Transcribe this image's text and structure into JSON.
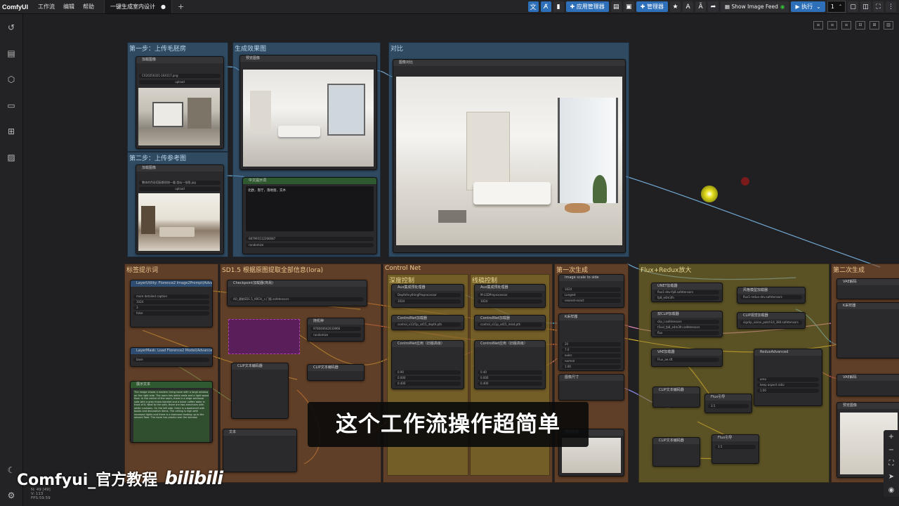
{
  "app": {
    "brand": "ComfyUI"
  },
  "menu": [
    "工作流",
    "编辑",
    "帮助"
  ],
  "tab": {
    "title": "一键生成室内设计",
    "dot": "●",
    "plus": "+"
  },
  "toolbar": {
    "app_manager": "应用管理器",
    "manager": "管理器",
    "show_image_feed": "Show Image Feed",
    "run": "执行",
    "run_count": "1"
  },
  "groups": {
    "step1": "第一步：上传毛胚房",
    "step2": "第二步：上传参考图",
    "result": "生成效果图",
    "compare": "对比",
    "tag": "标签提示词",
    "sd": "SD1.5 根据原图提取全部信息(lora)",
    "controlnet": "Control Net",
    "cn_depth": "深度控制",
    "cn_line": "线稿控制",
    "gen": "第一次生成",
    "flux": "Flux+Redux放大",
    "final": "第二次生成"
  },
  "nodes": {
    "load_image_1": "加载图像",
    "image_file_1": "CX20250321-164117.png",
    "upload_1": "upload",
    "load_image_2": "加载图像",
    "image_file_2": "整体的色彩搭配都很统一暖·类似一张图.jpg",
    "upload_2": "upload",
    "preview_1": "预览图像",
    "compare": "图像对比",
    "note_title": "中文提示词",
    "note_text": "北欧，客厅，落地窗，实木",
    "seed": "687991512266687",
    "control_after": "randomize",
    "florence": "LayerUtility: Florence2 Image2Prompt(Advance)",
    "florence_task": "more detailed caption",
    "florence_max": "1024",
    "florence_beams": "3",
    "florence_sample": "false",
    "florence_model": "LayerMask: Load Florence2 Model(Advance)",
    "florence_version": "base",
    "show_text": "展示文本",
    "show_text_body": "The image shows a modern living room with a large window on the right side. The room has white walls and a light wood floor. In the center of the room, there is a large sectional sofa with a grey throw blanket and a black coffee table in front of it. Next to the sofa, there are two armchairs with white cushions. On the left side, there is a bookshelf with books and decorative items. The ceiling is high with recessed lights and there is a staircase leading up to the second floor. The room has plants near the window.",
    "checkpoint": "Checkpoint加载器(简易)",
    "checkpoint_name": "AO_建筑SD1.5_ARCH_入门版.safetensors",
    "clip_encode": "CLIP文本编码器",
    "seed_node": "随机种",
    "seed_value": "978040642033966",
    "cn_depth_pre": "Aux集成预处理器",
    "cn_depth_model": "DepthAnythingPreprocessor",
    "cn_depth_res": "1024",
    "cn_line_pre": "Aux集成预处理器",
    "cn_line_model": "M-LSDPreprocessor",
    "cn_line_res": "1024",
    "cn_loader_1": "ControlNet加载器",
    "cn_file_1": "control_v11f1p_sd15_depth.pth",
    "cn_loader_2": "ControlNet加载器",
    "cn_file_2": "control_v11p_sd15_mlsd.pth",
    "cn_apply_1": "ControlNet应用（旧版高级）",
    "cn_apply_2": "ControlNet应用（旧版高级）",
    "cn_strength_1": "0.90",
    "cn_start_1": "0.000",
    "cn_end_1": "0.400",
    "cn_strength_2": "0.40",
    "cn_start_2": "0.000",
    "cn_end_2": "0.400",
    "scale": "Image scale to side",
    "scale_side": "1024",
    "scale_mode": "Longest",
    "scale_method": "nearest-exact",
    "ksampler": "K采样器",
    "steps": "20",
    "cfg": "7.0",
    "sampler": "euler",
    "scheduler": "normal",
    "denoise": "1.00",
    "image_size": "图像尺寸",
    "unet": "UNET加载器",
    "unet_name": "flux1-dev-fp8.safetensors",
    "unet_weight": "fp8_e4m3fn",
    "style_model": "风格模型加载器",
    "style_name": "flux1-redux-dev.safetensors",
    "clip_vision": "CLIP视觉加载器",
    "clip_vision_name": "sigclip_vision_patch14_384.safetensors",
    "dual_clip": "双CLIP加载器",
    "clip1": "clip_l.safetensors",
    "clip2": "t5xxl_fp8_e4m3fn.safetensors",
    "clip_type": "flux",
    "vae": "VAE加载器",
    "vae_name": "Flux_ae.sft",
    "redux": "ReduxAdvanced",
    "downsampling": "area",
    "mode": "keep aspect ratio",
    "strength": "1.00",
    "flux_guide_1": "Flux引导",
    "guide_1": "3.5",
    "flux_guide_2": "Flux引导",
    "guide_2": "3.5",
    "clip_enc_flux": "CLIP文本编码器",
    "clip_enc_flux2": "CLIP文本编码器",
    "vae_decode": "VAE解码",
    "vae_decode2": "VAE解码",
    "preview_final": "预览图像",
    "note_text2": "文本"
  },
  "overlay": {
    "subtitle": "这个工作流操作超简单",
    "watermark": "Comfyui_官方教程",
    "bili": "bilibili"
  },
  "stats": {
    "n": "N: 49 [49]",
    "v": "V: 113",
    "fps": "FPS:59.59"
  },
  "colors": {
    "accent": "#2d6fb8",
    "group_blue": "#3c6e96",
    "group_brown": "#82502d",
    "group_yellow": "#827328"
  }
}
